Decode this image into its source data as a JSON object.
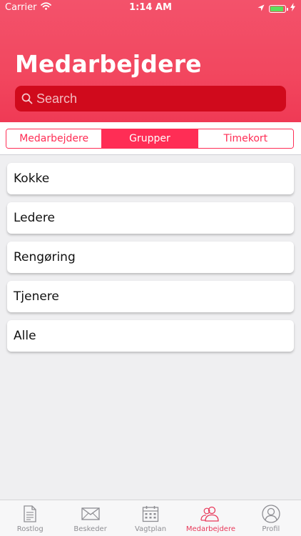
{
  "status_bar": {
    "carrier": "Carrier",
    "time": "1:14 AM"
  },
  "header": {
    "title": "Medarbejdere",
    "search_placeholder": "Search"
  },
  "segments": [
    {
      "label": "Medarbejdere",
      "active": false
    },
    {
      "label": "Grupper",
      "active": true
    },
    {
      "label": "Timekort",
      "active": false
    }
  ],
  "groups": [
    {
      "label": "Kokke"
    },
    {
      "label": "Ledere"
    },
    {
      "label": "Rengøring"
    },
    {
      "label": "Tjenere"
    },
    {
      "label": "Alle"
    }
  ],
  "tab_bar": {
    "items": [
      {
        "label": "Rostlog",
        "icon": "document-icon",
        "active": false
      },
      {
        "label": "Beskeder",
        "icon": "envelope-icon",
        "active": false
      },
      {
        "label": "Vagtplan",
        "icon": "calendar-icon",
        "active": false
      },
      {
        "label": "Medarbejdere",
        "icon": "people-icon",
        "active": true
      },
      {
        "label": "Profil",
        "icon": "user-icon",
        "active": false
      }
    ]
  },
  "colors": {
    "header_background": "#f2475f",
    "search_background": "#d00a1c",
    "accent": "#ff2d55",
    "active_tab": "#e8395a",
    "inactive_tab": "#8e8e93",
    "page_background": "#efeff1",
    "battery_fill": "#5cdd5c"
  }
}
